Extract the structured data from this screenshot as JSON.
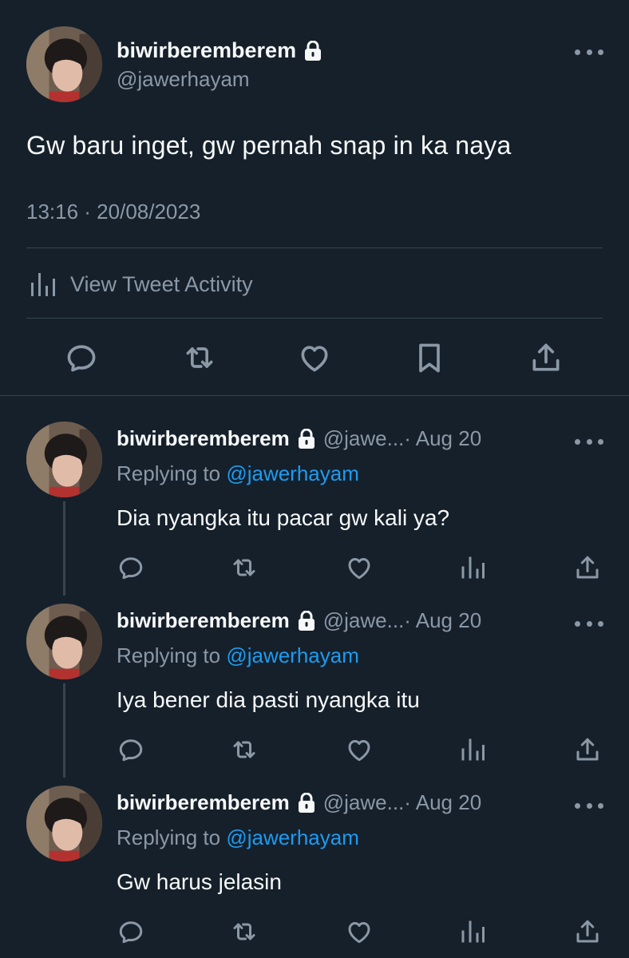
{
  "main_tweet": {
    "display_name": "biwirberemberem",
    "handle": "@jawerhayam",
    "text": "Gw baru inget, gw pernah snap in ka naya",
    "timestamp": "13:16 · 20/08/2023",
    "activity_label": "View Tweet Activity",
    "icons": [
      "lock-icon",
      "more-icon",
      "chart-icon",
      "reply-icon",
      "retweet-icon",
      "like-icon",
      "bookmark-icon",
      "share-icon"
    ]
  },
  "replies": [
    {
      "display_name": "biwirberemberem",
      "handle": "@jawe...",
      "date": " · Aug 20",
      "replying_prefix": "Replying to ",
      "replying_to": "@jawerhayam",
      "text": "Dia nyangka itu pacar gw kali ya?"
    },
    {
      "display_name": "biwirberemberem",
      "handle": "@jawe...",
      "date": " · Aug 20",
      "replying_prefix": "Replying to ",
      "replying_to": "@jawerhayam",
      "text": "Iya bener dia pasti nyangka itu"
    },
    {
      "display_name": "biwirberemberem",
      "handle": "@jawe...",
      "date": " · Aug 20",
      "replying_prefix": "Replying to ",
      "replying_to": "@jawerhayam",
      "text": "Gw harus jelasin"
    }
  ],
  "colors": {
    "background": "#15202b",
    "text_primary": "#f7f9f9",
    "text_secondary": "#8b98a5",
    "accent": "#1d9bf0",
    "divider": "#38444d"
  }
}
